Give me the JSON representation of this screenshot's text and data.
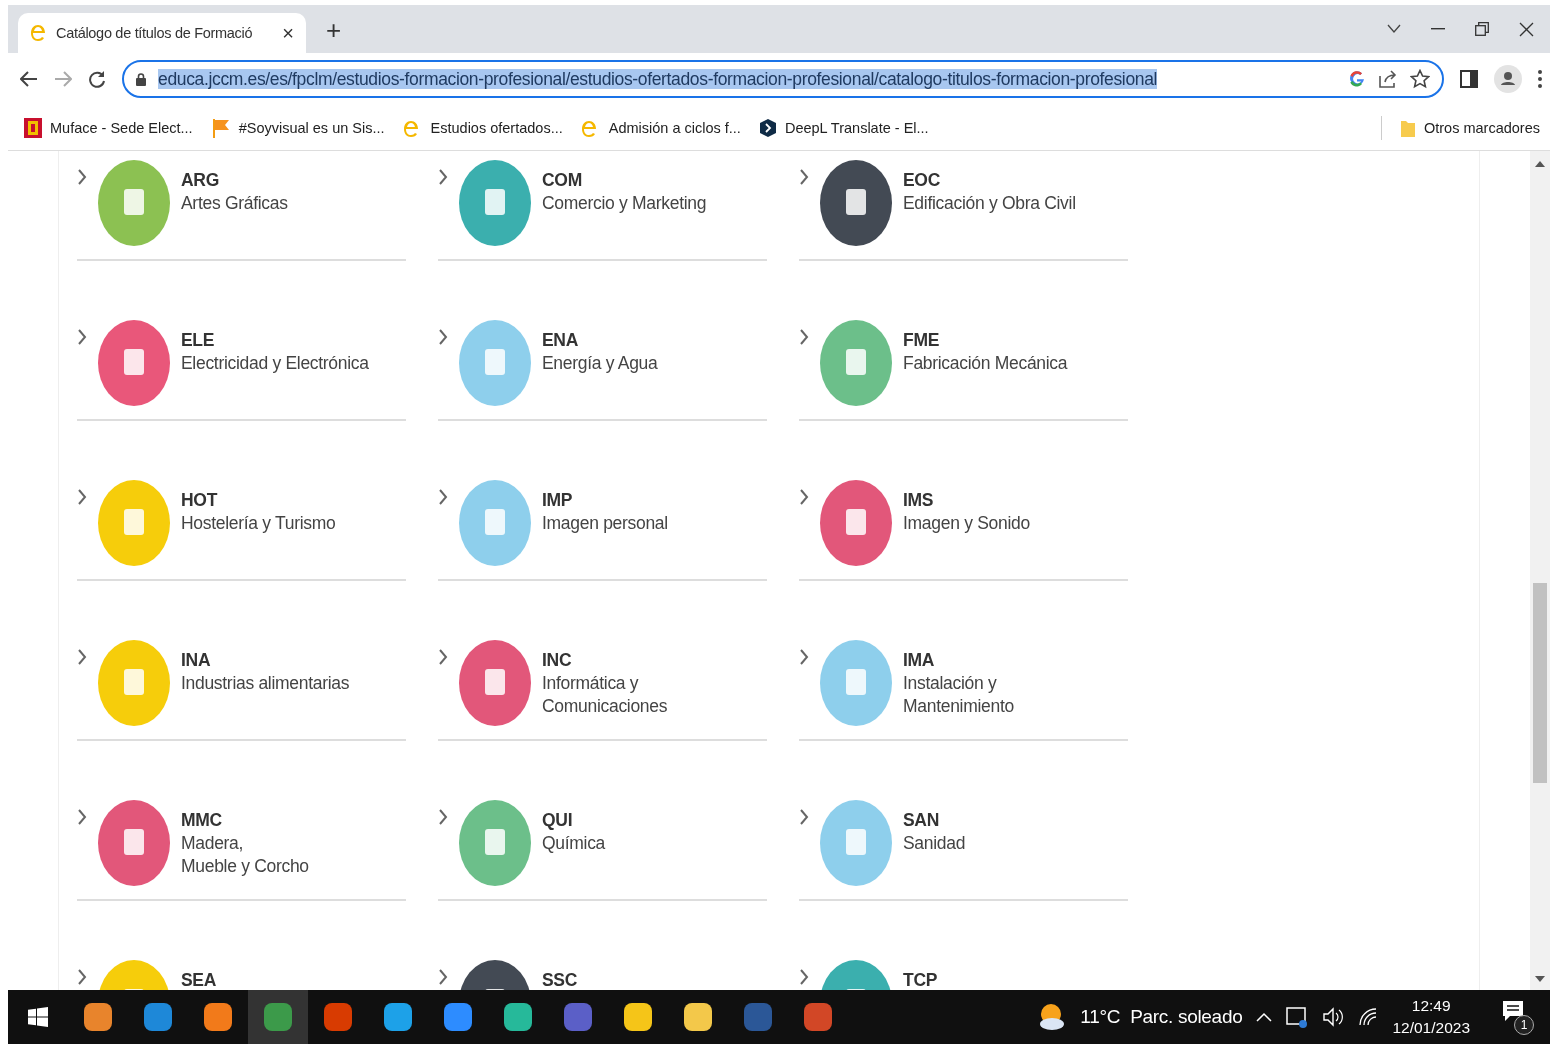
{
  "browser": {
    "tab": {
      "title": "Catálogo de títulos de Formació",
      "close": "×",
      "new_tab": "+"
    },
    "address": {
      "url": "educa.jccm.es/es/fpclm/estudios-formacion-profesional/estudios-ofertados-formacion-profesional/catalogo-titulos-formacion-profesional"
    },
    "bookmarks": [
      {
        "label": "Muface - Sede Elect...",
        "kind": "emblem"
      },
      {
        "label": "#Soyvisual es un Sis...",
        "kind": "flag"
      },
      {
        "label": "Estudios ofertados...",
        "kind": "letter"
      },
      {
        "label": "Admisión a ciclos f...",
        "kind": "letter"
      },
      {
        "label": "DeepL Translate - El...",
        "kind": "shield"
      }
    ],
    "other_bookmarks": "Otros marcadores"
  },
  "families": [
    {
      "code": "ARG",
      "name": "Artes Gráficas",
      "color": "#8cc152"
    },
    {
      "code": "COM",
      "name": "Comercio y Marketing",
      "color": "#3bafae"
    },
    {
      "code": "EOC",
      "name": "Edificación y Obra Civil",
      "color": "#434a54"
    },
    {
      "code": "ELE",
      "name": "Electricidad y Electrónica",
      "color": "#e9577a"
    },
    {
      "code": "ENA",
      "name": "Energía y Agua",
      "color": "#8ecfec"
    },
    {
      "code": "FME",
      "name": "Fabricación Mecánica",
      "color": "#6cbf8a"
    },
    {
      "code": "HOT",
      "name": "Hostelería y Turismo",
      "color": "#f6cd0b"
    },
    {
      "code": "IMP",
      "name": "Imagen personal",
      "color": "#8ecfec"
    },
    {
      "code": "IMS",
      "name": "Imagen y Sonido",
      "color": "#e2577a"
    },
    {
      "code": "INA",
      "name": "Industrias alimentarias",
      "color": "#f6cd0b"
    },
    {
      "code": "INC",
      "name": "Informática y Comunicaciones",
      "color": "#e2577a"
    },
    {
      "code": "IMA",
      "name": "Instalación y\nMantenimiento",
      "color": "#8ecfec"
    },
    {
      "code": "MMC",
      "name": "Madera,\nMueble y Corcho",
      "color": "#e2577a"
    },
    {
      "code": "QUI",
      "name": "Química",
      "color": "#6cbf8a"
    },
    {
      "code": "SAN",
      "name": "Sanidad",
      "color": "#8ecfec"
    },
    {
      "code": "SEA",
      "color": "#f6cd0b"
    },
    {
      "code": "SSC",
      "color": "#434a54"
    },
    {
      "code": "TCP",
      "color": "#3bafae"
    }
  ],
  "taskbar": {
    "apps": [
      {
        "color": "#e8842c",
        "selected": false
      },
      {
        "color": "#1e88d8",
        "selected": false
      },
      {
        "color": "#f27a1a",
        "selected": false
      },
      {
        "color": "#3c9a4a",
        "selected": true
      },
      {
        "color": "#d83b01",
        "selected": false
      },
      {
        "color": "#1da1e8",
        "selected": false
      },
      {
        "color": "#2d8cff",
        "selected": false
      },
      {
        "color": "#26b99a",
        "selected": false
      },
      {
        "color": "#5b5fc7",
        "selected": false
      },
      {
        "color": "#f5c518",
        "selected": false
      },
      {
        "color": "#f3c84a",
        "selected": false
      },
      {
        "color": "#2b5797",
        "selected": false
      },
      {
        "color": "#d24726",
        "selected": false
      }
    ],
    "weather": "11°C  Parc. soleado",
    "time": "12:49",
    "date": "12/01/2023",
    "notifications": "1"
  }
}
